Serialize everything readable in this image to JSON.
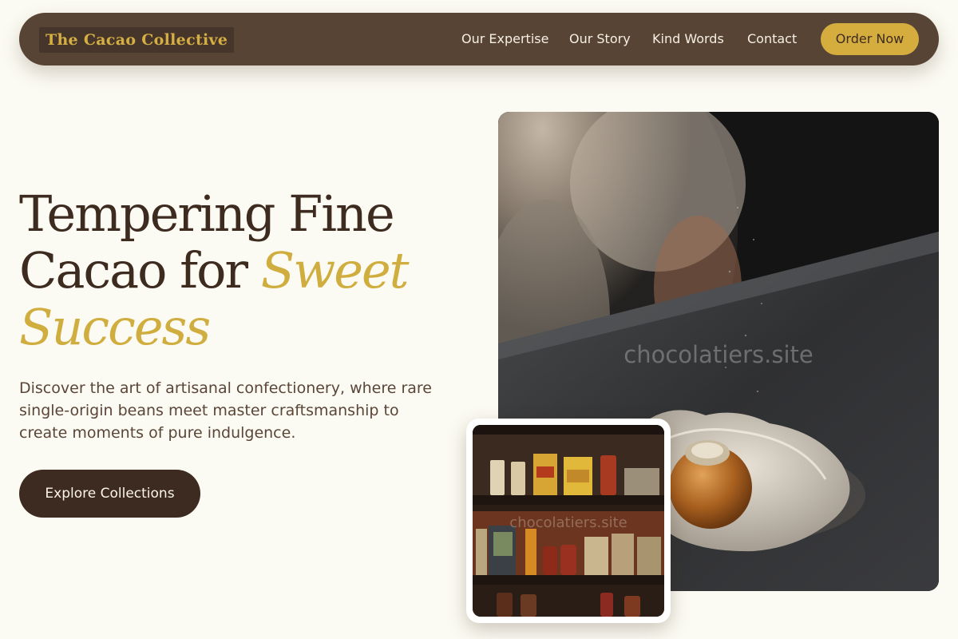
{
  "nav": {
    "logo": "The Cacao Collective",
    "links": [
      {
        "label": "Our Expertise"
      },
      {
        "label": "Our Story"
      },
      {
        "label": "Kind Words"
      },
      {
        "label": "Contact"
      }
    ],
    "cta": "Order Now"
  },
  "hero": {
    "title_line1": "Tempering Fine",
    "title_line2": "Cacao for ",
    "title_accent1": "Sweet",
    "title_accent2": "Success",
    "description": "Discover the art of artisanal confectionery, where rare single-origin beans meet master craftsmanship to create moments of pure indulgence.",
    "button": "Explore Collections"
  },
  "images": {
    "main_watermark": "chocolatiers.site",
    "inset_watermark": "chocolatiers.site"
  },
  "colors": {
    "nav_bg": "#574434",
    "accent_gold": "#d5ad3f",
    "dark_brown": "#3d2b20",
    "page_bg": "#fcfbf3"
  }
}
